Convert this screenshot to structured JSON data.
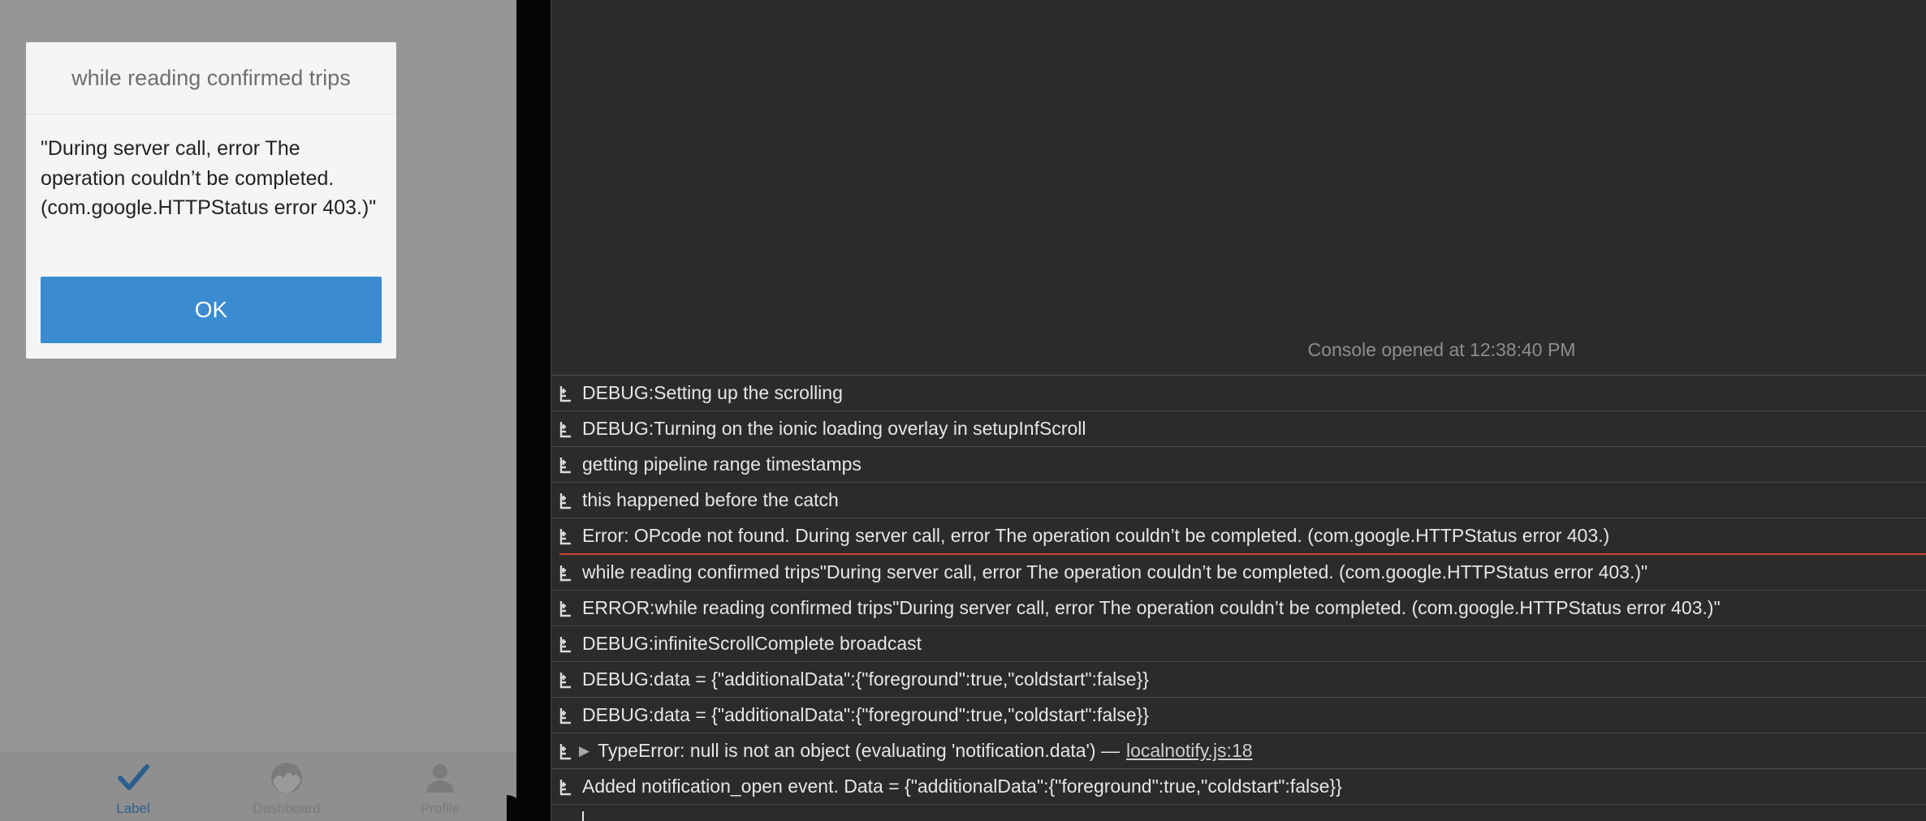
{
  "alert": {
    "title": "while reading confirmed trips",
    "message": "\"During server call, error The operation couldn’t be completed. (com.google.HTTPStatus error 403.)\"",
    "ok_label": "OK"
  },
  "tabbar": {
    "tabs": [
      {
        "label": "Label",
        "icon": "checkmark-icon",
        "active": true
      },
      {
        "label": "Dashboard",
        "icon": "dashboard-icon",
        "active": false
      },
      {
        "label": "Profile",
        "icon": "person-icon",
        "active": false
      }
    ]
  },
  "console": {
    "opened_text": "Console opened at 12:38:40 PM",
    "rows": [
      {
        "text": "DEBUG:Setting up the scrolling"
      },
      {
        "text": "DEBUG:Turning on the ionic loading overlay in setupInfScroll"
      },
      {
        "text": "getting pipeline range timestamps"
      },
      {
        "text": "this happened before the catch"
      },
      {
        "text": "Error: OPcode not found. During server call, error The operation couldn’t be completed. (com.google.HTTPStatus error 403.)"
      },
      {
        "text": "while reading confirmed trips\"During server call, error The operation couldn’t be completed. (com.google.HTTPStatus error 403.)\""
      },
      {
        "text": "ERROR:while reading confirmed trips\"During server call, error The operation couldn’t be completed. (com.google.HTTPStatus error 403.)\""
      },
      {
        "text": "DEBUG:infiniteScrollComplete broadcast"
      },
      {
        "text": "DEBUG:data = {\"additionalData\":{\"foreground\":true,\"coldstart\":false}}"
      },
      {
        "text": "DEBUG:data = {\"additionalData\":{\"foreground\":true,\"coldstart\":false}}"
      },
      {
        "text": "TypeError: null is not an object (evaluating 'notification.data') —",
        "link": "localnotify.js:18"
      },
      {
        "text": "Added notification_open event. Data = {\"additionalData\":{\"foreground\":true,\"coldstart\":false}}"
      }
    ]
  },
  "colors": {
    "accent": "#3a8bd0",
    "active_tab": "#2c5f8d",
    "error_underline": "#d0412f",
    "console_bg": "#2b2b2b"
  }
}
